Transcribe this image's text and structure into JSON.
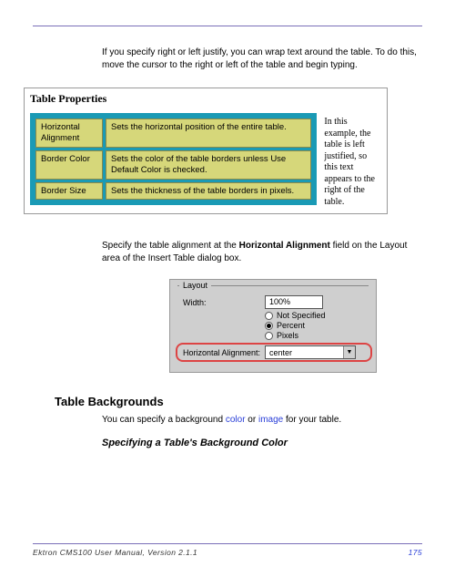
{
  "topRule": true,
  "intro": "If you specify right or left justify, you can wrap text around the table. To do this, move the cursor to the right or left of the table and begin typing.",
  "fig1": {
    "title": "Table Properties",
    "rows": [
      {
        "label": "Horizontal Alignment",
        "desc": "Sets the horizontal position of the entire table."
      },
      {
        "label": "Border Color",
        "desc": "Sets the color of the table borders unless Use Default Color is checked."
      },
      {
        "label": "Border Size",
        "desc": "Sets the thickness of the table borders in pixels."
      }
    ],
    "caption": "In this example, the table is left justified, so this text appears to the right of the table."
  },
  "para2_pre": "Specify the table alignment at the ",
  "para2_bold": "Horizontal Alignment",
  "para2_post": " field on the Layout area of the Insert Table dialog box.",
  "fig2": {
    "legend": "Layout",
    "widthLabel": "Width:",
    "widthValue": "100%",
    "radios": [
      {
        "label": "Not Specified",
        "checked": false
      },
      {
        "label": "Percent",
        "checked": true
      },
      {
        "label": "Pixels",
        "checked": false
      }
    ],
    "halignLabel": "Horizontal Alignment:",
    "halignValue": "center"
  },
  "h2": "Table Backgrounds",
  "para3_pre": "You can specify a background ",
  "para3_link1": "color",
  "para3_mid": " or ",
  "para3_link2": "image",
  "para3_post": " for your table.",
  "h3": "Specifying a Table's Background Color",
  "footer": {
    "left": "Ektron CMS100 User Manual, Version 2.1.1",
    "page": "175"
  }
}
